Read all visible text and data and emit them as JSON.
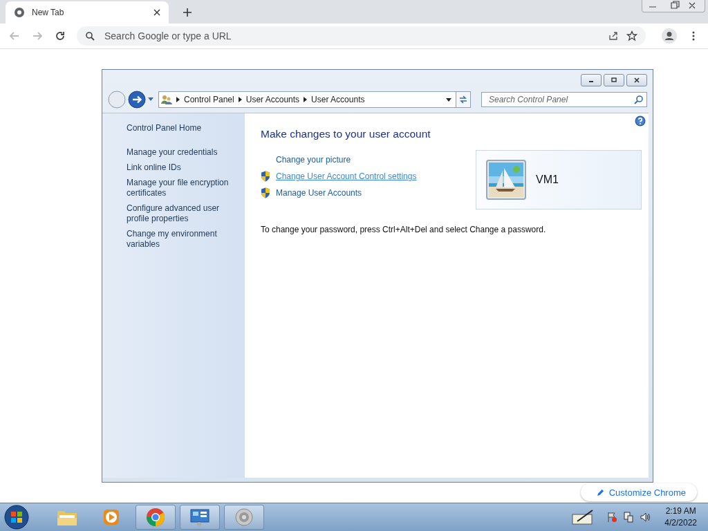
{
  "browser": {
    "tab": {
      "title": "New Tab"
    },
    "omnibox": {
      "placeholder": "Search Google or type a URL"
    }
  },
  "window": {
    "breadcrumb": [
      "Control Panel",
      "User Accounts",
      "User Accounts"
    ],
    "search": {
      "placeholder": "Search Control Panel"
    },
    "sidebar": {
      "items": [
        {
          "label": "Control Panel Home",
          "kind": "home"
        },
        {
          "label": "Manage your credentials",
          "kind": "link"
        },
        {
          "label": "Link online IDs",
          "kind": "link"
        },
        {
          "label": "Manage your file encryption certificates",
          "kind": "link"
        },
        {
          "label": "Configure advanced user profile properties",
          "kind": "link"
        },
        {
          "label": "Change my environment variables",
          "kind": "link"
        }
      ]
    },
    "heading": "Make changes to your user account",
    "tasks": [
      {
        "label": "Change your picture",
        "shield": false,
        "hovered": false
      },
      {
        "label": "Change User Account Control settings",
        "shield": true,
        "hovered": true
      },
      {
        "label": "Manage User Accounts",
        "shield": true,
        "hovered": false
      }
    ],
    "account": {
      "name": "VM1"
    },
    "note": "To change your password, press Ctrl+Alt+Del and select Change a password."
  },
  "customize": {
    "label": "Customize Chrome"
  },
  "taskbar": {
    "apps": [
      {
        "kind": "folder",
        "running": false
      },
      {
        "kind": "media",
        "running": false
      },
      {
        "kind": "chrome",
        "running": true
      },
      {
        "kind": "control-panel",
        "running": true
      },
      {
        "kind": "speaker",
        "running": true
      }
    ],
    "clock": {
      "time": "2:19 AM",
      "date": "4/2/2022"
    }
  }
}
